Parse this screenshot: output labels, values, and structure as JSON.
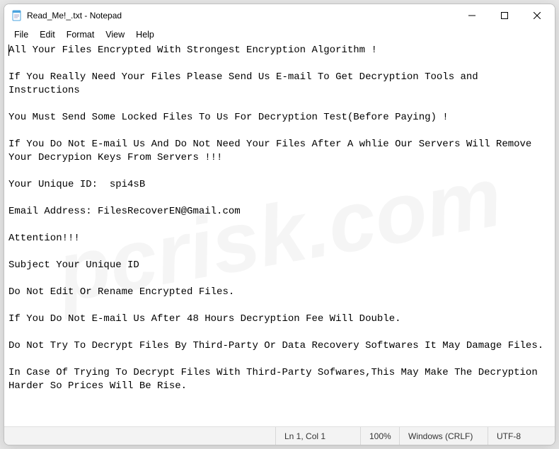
{
  "window": {
    "title": "Read_Me!_.txt - Notepad"
  },
  "menu": {
    "file": "File",
    "edit": "Edit",
    "format": "Format",
    "view": "View",
    "help": "Help"
  },
  "content": {
    "body": "All Your Files Encrypted With Strongest Encryption Algorithm !\n\nIf You Really Need Your Files Please Send Us E-mail To Get Decryption Tools and Instructions\n\nYou Must Send Some Locked Files To Us For Decryption Test(Before Paying) !\n\nIf You Do Not E-mail Us And Do Not Need Your Files After A whlie Our Servers Will Remove Your Decrypion Keys From Servers !!!\n\nYour Unique ID:  spi4sB\n\nEmail Address: FilesRecoverEN@Gmail.com\n\nAttention!!!\n\nSubject Your Unique ID\n\nDo Not Edit Or Rename Encrypted Files.\n\nIf You Do Not E-mail Us After 48 Hours Decryption Fee Will Double.\n\nDo Not Try To Decrypt Files By Third-Party Or Data Recovery Softwares It May Damage Files.\n\nIn Case Of Trying To Decrypt Files With Third-Party Sofwares,This May Make The Decryption Harder So Prices Will Be Rise."
  },
  "status": {
    "pos": "Ln 1, Col 1",
    "zoom": "100%",
    "eol": "Windows (CRLF)",
    "enc": "UTF-8"
  }
}
